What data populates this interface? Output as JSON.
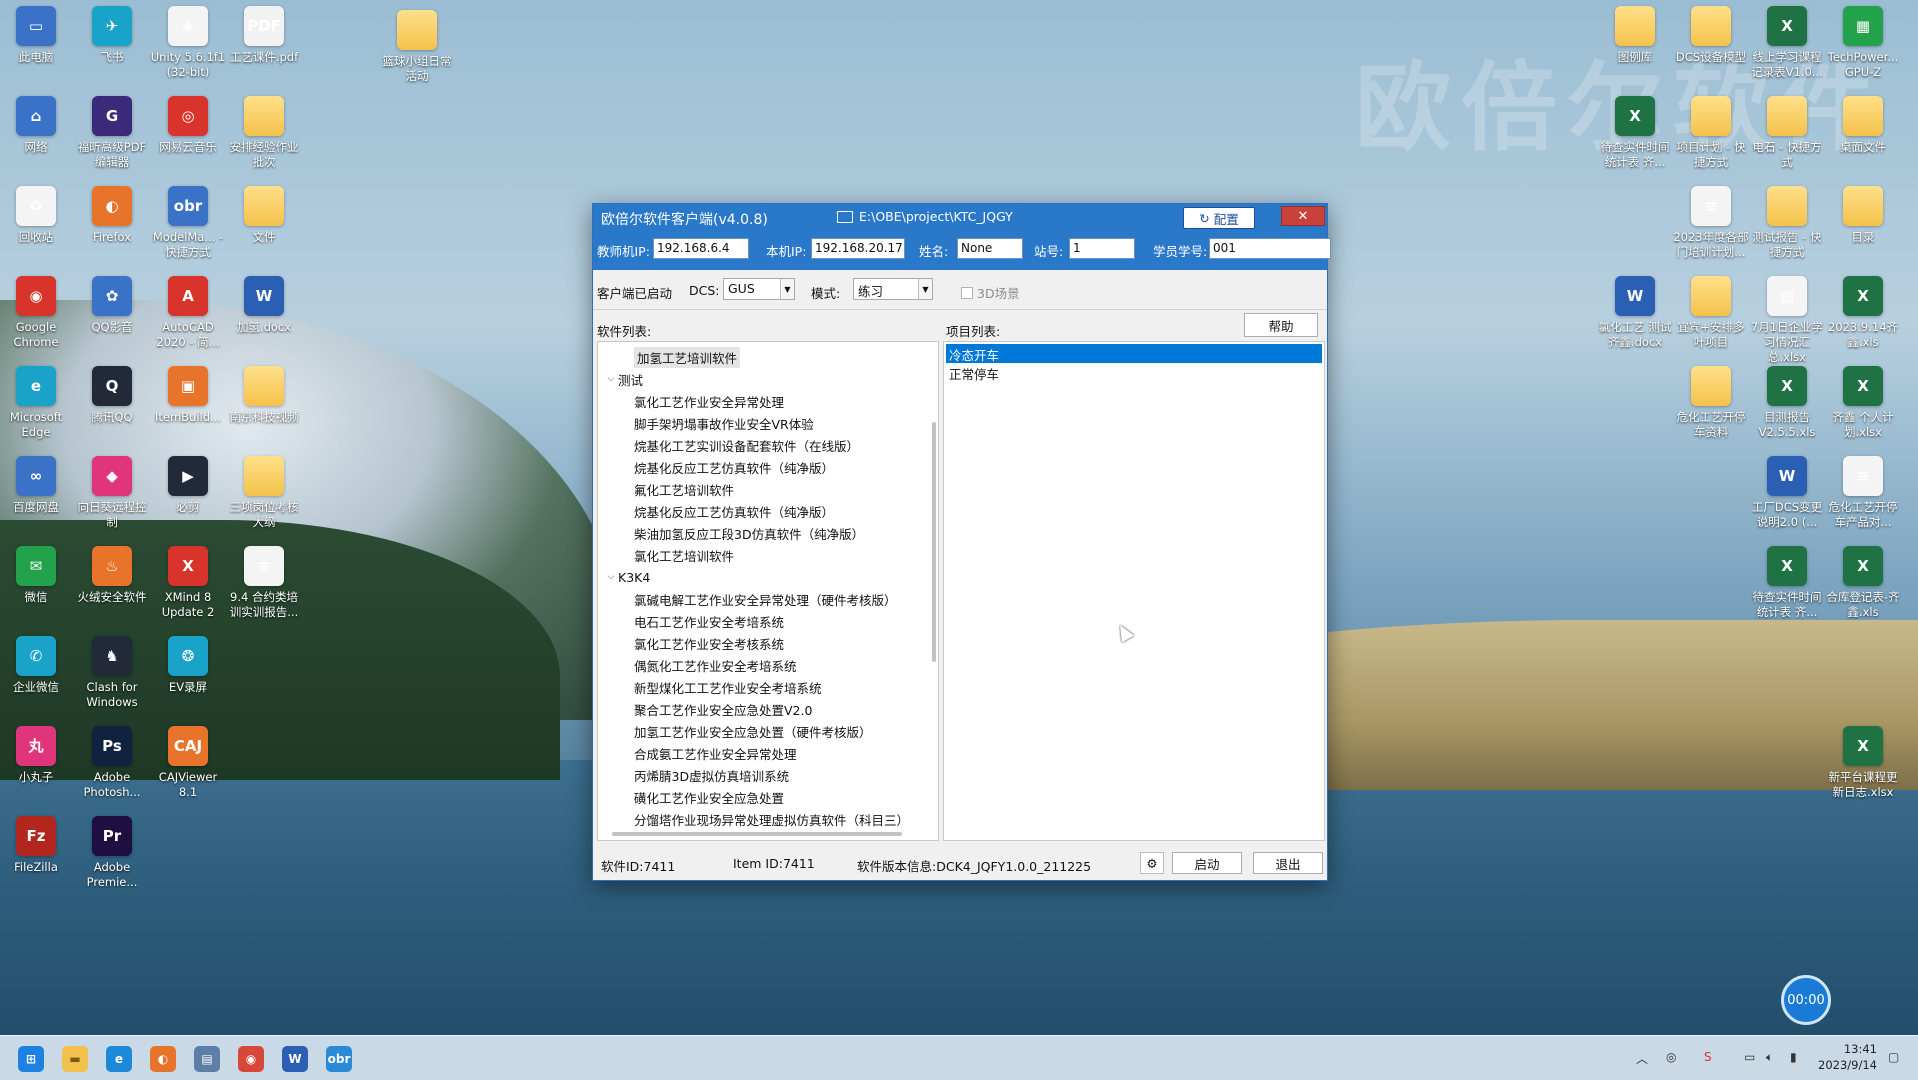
{
  "watermark": "欧倍尔软件",
  "desktop": {
    "left_icons": [
      {
        "label": "此电脑",
        "icon": "computer-icon",
        "glyph": "▭"
      },
      {
        "label": "飞书",
        "icon": "feishu-icon",
        "glyph": "✈"
      },
      {
        "label": "Unity 5.6.1f1 (32-bit)",
        "icon": "unity-icon",
        "glyph": "◈"
      },
      {
        "label": "工艺课件.pdf",
        "icon": "pdf-icon",
        "glyph": "PDF"
      },
      {
        "label": "篮球小组日常活动",
        "icon": "folder-icon",
        "glyph": ""
      },
      {
        "label": "网络",
        "icon": "network-icon",
        "glyph": "⌂"
      },
      {
        "label": "福昕高级PDF编辑器",
        "icon": "foxit-icon",
        "glyph": "G"
      },
      {
        "label": "网易云音乐",
        "icon": "netease-music-icon",
        "glyph": "◎"
      },
      {
        "label": "安排经验作业批次",
        "icon": "folder-icon",
        "glyph": ""
      },
      {
        "label": "回收站",
        "icon": "recycle-bin-icon",
        "glyph": "♻"
      },
      {
        "label": "Firefox",
        "icon": "firefox-icon",
        "glyph": "◐"
      },
      {
        "label": "ModelMa... - 快捷方式",
        "icon": "modelmaker-icon",
        "glyph": "obr"
      },
      {
        "label": "文件",
        "icon": "folder-icon",
        "glyph": ""
      },
      {
        "label": "Google Chrome",
        "icon": "chrome-icon",
        "glyph": "◉"
      },
      {
        "label": "QQ影音",
        "icon": "qq-video-icon",
        "glyph": "✿"
      },
      {
        "label": "AutoCAD 2020 - 简...",
        "icon": "autocad-icon",
        "glyph": "A"
      },
      {
        "label": "加氢.docx",
        "icon": "word-icon",
        "glyph": "W"
      },
      {
        "label": "Microsoft Edge",
        "icon": "edge-icon",
        "glyph": "e"
      },
      {
        "label": "腾讯QQ",
        "icon": "qq-icon",
        "glyph": "Q"
      },
      {
        "label": "ItemBuild...",
        "icon": "itembuild-icon",
        "glyph": "▣"
      },
      {
        "label": "南京科技视频",
        "icon": "folder-icon",
        "glyph": ""
      },
      {
        "label": "百度网盘",
        "icon": "baidu-netdisk-icon",
        "glyph": "∞"
      },
      {
        "label": "向日葵远程控制",
        "icon": "sunlogin-icon",
        "glyph": "◆"
      },
      {
        "label": "必剪",
        "icon": "bijian-icon",
        "glyph": "▶"
      },
      {
        "label": "三项岗位考核大纲",
        "icon": "folder-icon",
        "glyph": ""
      },
      {
        "label": "微信",
        "icon": "wechat-icon",
        "glyph": "✉"
      },
      {
        "label": "火绒安全软件",
        "icon": "huorong-icon",
        "glyph": "♨"
      },
      {
        "label": "XMind 8 Update 2",
        "icon": "xmind-icon",
        "glyph": "X"
      },
      {
        "label": "9.4 合约类培训实训报告...",
        "icon": "file-icon",
        "glyph": "≡"
      },
      {
        "label": "企业微信",
        "icon": "wecom-icon",
        "glyph": "✆"
      },
      {
        "label": "Clash for Windows",
        "icon": "clash-icon",
        "glyph": "♞"
      },
      {
        "label": "EV录屏",
        "icon": "ev-recorder-icon",
        "glyph": "❂"
      },
      {
        "label": "小丸子",
        "icon": "xiaowanzi-icon",
        "glyph": "丸"
      },
      {
        "label": "Adobe Photosh...",
        "icon": "photoshop-icon",
        "glyph": "Ps"
      },
      {
        "label": "CAJViewer 8.1",
        "icon": "cajviewer-icon",
        "glyph": "CAJ"
      },
      {
        "label": "FileZilla",
        "icon": "filezilla-icon",
        "glyph": "Fz"
      },
      {
        "label": "Adobe Premie...",
        "icon": "premiere-icon",
        "glyph": "Pr"
      }
    ],
    "right_icons": [
      {
        "label": "图例库",
        "icon": "folder-icon",
        "glyph": ""
      },
      {
        "label": "DCS设备模型",
        "icon": "folder-icon",
        "glyph": ""
      },
      {
        "label": "线上学习课程记录表V1.0...",
        "icon": "excel-icon",
        "glyph": "X"
      },
      {
        "label": "TechPower... GPU-Z",
        "icon": "gpuz-icon",
        "glyph": "▦"
      },
      {
        "label": "待查实件时间统计表 齐...",
        "icon": "excel-icon",
        "glyph": "X"
      },
      {
        "label": "项目计划 - 快捷方式",
        "icon": "folder-icon",
        "glyph": ""
      },
      {
        "label": "电石 - 快捷方式",
        "icon": "folder-icon",
        "glyph": ""
      },
      {
        "label": "桌面文件",
        "icon": "folder-icon",
        "glyph": ""
      },
      {
        "label": "2023年度各部门培训计划...",
        "icon": "doc-icon",
        "glyph": "≡"
      },
      {
        "label": "测试报告 - 快捷方式",
        "icon": "folder-icon",
        "glyph": ""
      },
      {
        "label": "目录",
        "icon": "folder-icon",
        "glyph": ""
      },
      {
        "label": "氯化工艺 测试 齐鑫.docx",
        "icon": "word-icon",
        "glyph": "W"
      },
      {
        "label": "宜宾+安排多叶项目",
        "icon": "folder-icon",
        "glyph": ""
      },
      {
        "label": "7月1日企业学习情况汇总.xlsx",
        "icon": "file-icon",
        "glyph": "▤"
      },
      {
        "label": "2023.9.14齐鑫.xls",
        "icon": "excel-icon",
        "glyph": "X"
      },
      {
        "label": "危化工艺开停车资料",
        "icon": "folder-icon",
        "glyph": ""
      },
      {
        "label": "目测报告V2.5.5.xls",
        "icon": "excel-icon",
        "glyph": "X"
      },
      {
        "label": "齐鑫 个人计划.xlsx",
        "icon": "excel-icon",
        "glyph": "X"
      },
      {
        "label": "工厂DCS变更说明2.0 (...",
        "icon": "word-icon",
        "glyph": "W"
      },
      {
        "label": "危化工艺开停车产品对...",
        "icon": "file-icon",
        "glyph": "≡"
      },
      {
        "label": "待查实件时间统计表 齐...",
        "icon": "excel-icon",
        "glyph": "X"
      },
      {
        "label": "合库登记表-齐鑫.xls",
        "icon": "excel-icon",
        "glyph": "X"
      },
      {
        "label": "新平台课程更新日志.xlsx",
        "icon": "excel-icon",
        "glyph": "X"
      }
    ]
  },
  "app": {
    "title": "欧倍尔软件客户端(v4.0.8)",
    "path": "E:\\OBE\\project\\KTC_JQGY",
    "config_button": "配置",
    "close_button": "✕",
    "fields": {
      "teacher_ip_label": "教师机IP:",
      "teacher_ip": "192.168.6.4",
      "local_ip_label": "本机IP:",
      "local_ip": "192.168.20.17",
      "name_label": "姓名:",
      "name": "None",
      "station_label": "站号:",
      "station": "1",
      "student_id_label": "学员学号:",
      "student_id": "001"
    },
    "toolbar": {
      "client_status": "客户端已启动",
      "dcs_label": "DCS:",
      "dcs_value": "GUS",
      "mode_label": "模式:",
      "mode_value": "练习",
      "scene3d_label": "3D场景"
    },
    "software_list_label": "软件列表:",
    "project_list_label": "项目列表:",
    "help_button": "帮助",
    "tree": [
      {
        "text": "加氢工艺培训软件",
        "level": 1,
        "twisty": ""
      },
      {
        "text": "测试",
        "level": 0,
        "twisty": "⌵"
      },
      {
        "text": "氯化工艺作业安全异常处理",
        "level": 1,
        "twisty": ""
      },
      {
        "text": "脚手架坍塌事故作业安全VR体验",
        "level": 1,
        "twisty": ""
      },
      {
        "text": "烷基化工艺实训设备配套软件（在线版）",
        "level": 1,
        "twisty": ""
      },
      {
        "text": "烷基化反应工艺仿真软件（纯净版）",
        "level": 1,
        "twisty": ""
      },
      {
        "text": "氟化工艺培训软件",
        "level": 1,
        "twisty": ""
      },
      {
        "text": "烷基化反应工艺仿真软件（纯净版）",
        "level": 1,
        "twisty": ""
      },
      {
        "text": "柴油加氢反应工段3D仿真软件（纯净版）",
        "level": 1,
        "twisty": ""
      },
      {
        "text": "氯化工艺培训软件",
        "level": 1,
        "twisty": ""
      },
      {
        "text": "K3K4",
        "level": 0,
        "twisty": "⌵"
      },
      {
        "text": "氯碱电解工艺作业安全异常处理（硬件考核版）",
        "level": 1,
        "twisty": ""
      },
      {
        "text": "电石工艺作业安全考培系统",
        "level": 1,
        "twisty": ""
      },
      {
        "text": "氯化工艺作业安全考核系统",
        "level": 1,
        "twisty": ""
      },
      {
        "text": "偶氮化工艺作业安全考培系统",
        "level": 1,
        "twisty": ""
      },
      {
        "text": "新型煤化工工艺作业安全考培系统",
        "level": 1,
        "twisty": ""
      },
      {
        "text": "聚合工艺作业安全应急处置V2.0",
        "level": 1,
        "twisty": ""
      },
      {
        "text": "加氢工艺作业安全应急处置（硬件考核版）",
        "level": 1,
        "twisty": ""
      },
      {
        "text": "合成氨工艺作业安全异常处理",
        "level": 1,
        "twisty": ""
      },
      {
        "text": "丙烯腈3D虚拟仿真培训系统",
        "level": 1,
        "twisty": ""
      },
      {
        "text": "磺化工艺作业安全应急处置",
        "level": 1,
        "twisty": ""
      },
      {
        "text": "分馏塔作业现场异常处理虚拟仿真软件（科目三）",
        "level": 1,
        "twisty": ""
      }
    ],
    "projects": [
      "冷态开车",
      "正常停车"
    ],
    "status": {
      "software_id": "软件ID:7411",
      "item_id": "Item ID:7411",
      "version": "软件版本信息:DCK4_JQFY1.0.0_211225",
      "start_button": "启动",
      "exit_button": "退出"
    }
  },
  "timer": "00:00",
  "clock": {
    "time": "13:41",
    "date": "2023/9/14"
  }
}
